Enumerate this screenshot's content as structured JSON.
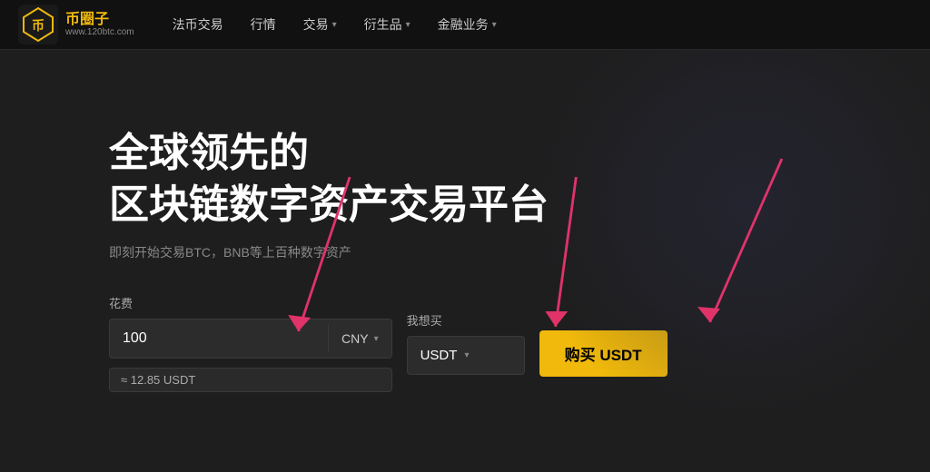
{
  "nav": {
    "logo_url": "www.120btc.com",
    "logo_alt": "币圈子",
    "items": [
      {
        "label": "法币交易",
        "has_arrow": false
      },
      {
        "label": "行情",
        "has_arrow": false
      },
      {
        "label": "交易",
        "has_arrow": true
      },
      {
        "label": "衍生品",
        "has_arrow": true
      },
      {
        "label": "金融业务",
        "has_arrow": true
      }
    ]
  },
  "hero": {
    "headline1": "全球领先的",
    "headline2": "区块链数字资产交易平台",
    "subtext": "即刻开始交易BTC，BNB等上百种数字资产"
  },
  "form": {
    "spend_label": "花费",
    "spend_value": "100",
    "spend_currency": "CNY",
    "buy_label": "我想买",
    "buy_currency": "USDT",
    "approx": "≈ 12.85 USDT",
    "buy_button": "购买 USDT"
  }
}
